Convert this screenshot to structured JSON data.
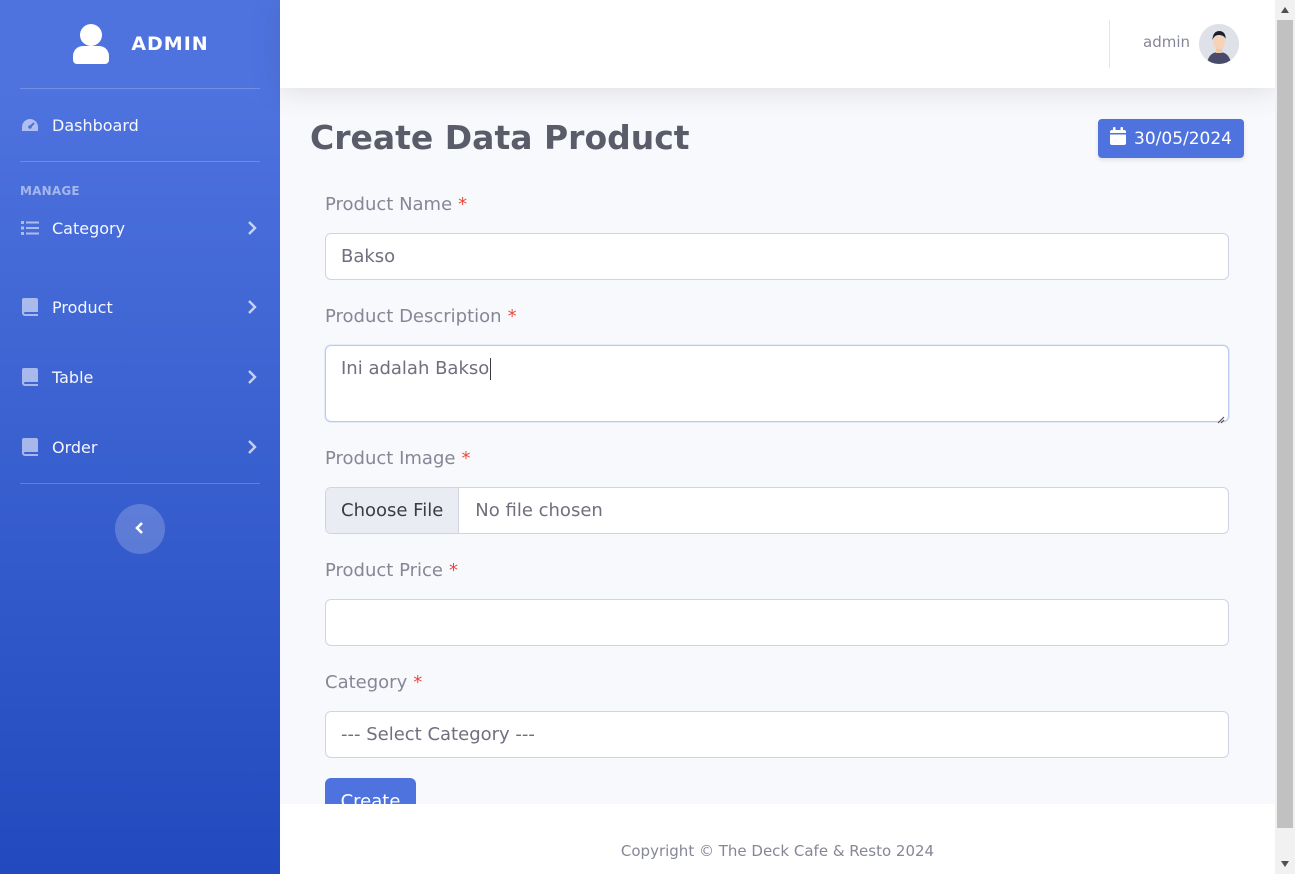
{
  "sidebar": {
    "brand": "ADMIN",
    "dashboard": "Dashboard",
    "heading": "MANAGE",
    "items": [
      {
        "label": "Category",
        "icon": "list-icon"
      },
      {
        "label": "Product",
        "icon": "book-icon"
      },
      {
        "label": "Table",
        "icon": "book-icon"
      },
      {
        "label": "Order",
        "icon": "book-icon"
      }
    ]
  },
  "topbar": {
    "user": "admin"
  },
  "page": {
    "title": "Create Data Product",
    "date": "30/05/2024"
  },
  "form": {
    "name_label": "Product Name",
    "name_value": "Bakso",
    "desc_label": "Product Description",
    "desc_value": "Ini adalah Bakso",
    "image_label": "Product Image",
    "image_button": "Choose File",
    "image_status": "No file chosen",
    "price_label": "Product Price",
    "price_value": "",
    "category_label": "Category",
    "category_value": "--- Select Category ---",
    "required_mark": "*",
    "submit": "Create"
  },
  "footer": {
    "copyright": "Copyright © The Deck Cafe & Resto 2024"
  },
  "colors": {
    "primary": "#4e73df",
    "required": "#e74a3b"
  }
}
